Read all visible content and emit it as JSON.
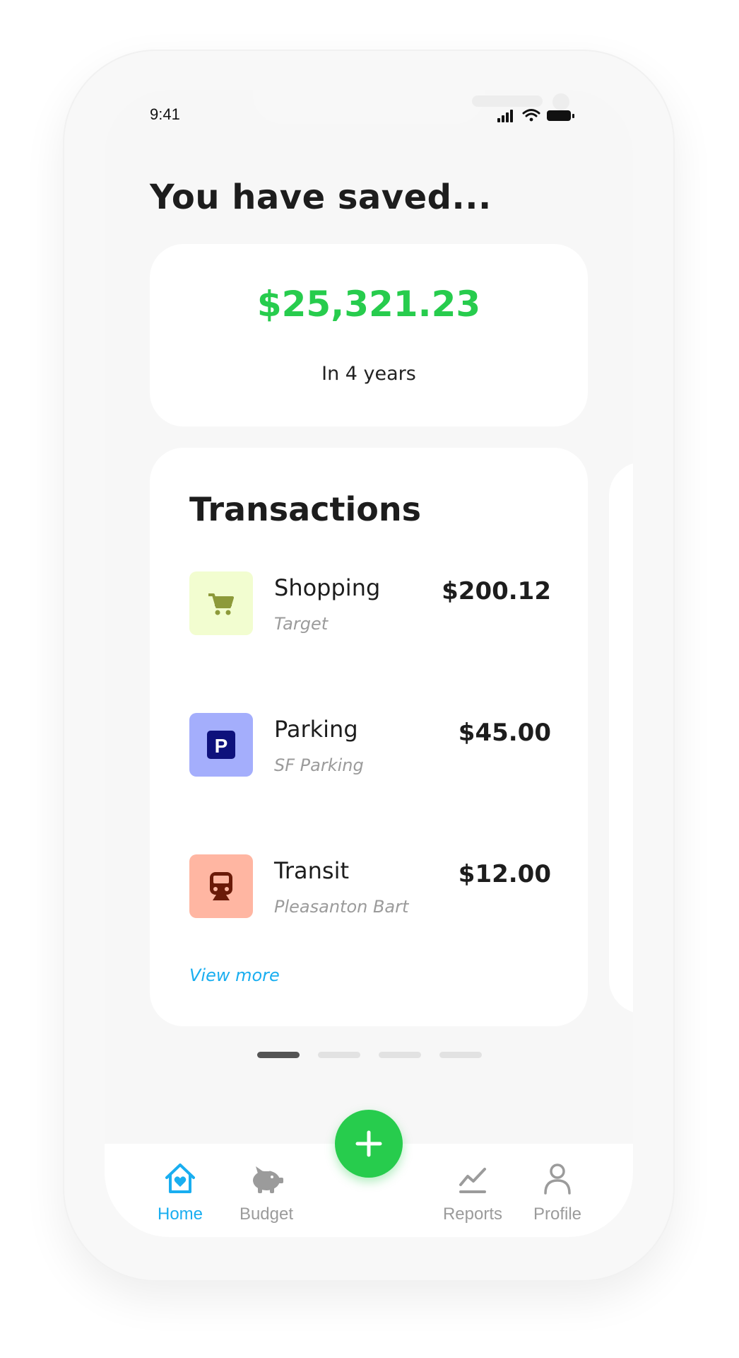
{
  "status_bar": {
    "time": "9:41"
  },
  "headline": "You have saved...",
  "savings": {
    "amount": "$25,321.23",
    "period": "In 4 years"
  },
  "transactions": {
    "title": "Transactions",
    "items": [
      {
        "name": "Shopping",
        "merchant": "Target",
        "amount": "$200.12",
        "icon": "shopping-cart-icon",
        "icon_bg": "#f2fdd0",
        "icon_color": "#8d9a3a"
      },
      {
        "name": "Parking",
        "merchant": "SF Parking",
        "amount": "$45.00",
        "icon": "parking-icon",
        "icon_bg": "#a4aefc",
        "icon_color": "#0e117c"
      },
      {
        "name": "Transit",
        "merchant": "Pleasanton Bart",
        "amount": "$12.00",
        "icon": "train-icon",
        "icon_bg": "#ffb6a2",
        "icon_color": "#6a1a08"
      }
    ],
    "view_more": "View more"
  },
  "pager": {
    "count": 4,
    "active_index": 0
  },
  "tab_bar": {
    "tabs": [
      {
        "label": "Home",
        "icon": "home-icon",
        "active": true
      },
      {
        "label": "Budget",
        "icon": "piggy-bank-icon",
        "active": false
      },
      {
        "label": "Reports",
        "icon": "chart-icon",
        "active": false
      },
      {
        "label": "Profile",
        "icon": "profile-icon",
        "active": false
      }
    ],
    "fab_icon": "plus-icon"
  },
  "colors": {
    "accent_green": "#27cc4d",
    "accent_blue": "#19aef0",
    "text_dark": "#1d1d1d",
    "text_muted": "#9b9b9b"
  }
}
